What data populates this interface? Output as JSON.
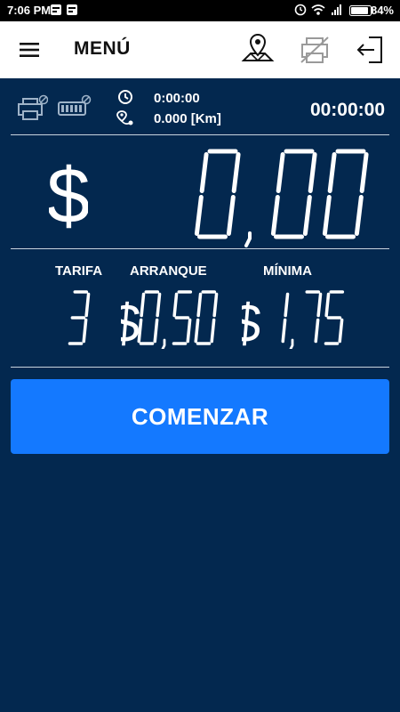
{
  "status_bar": {
    "time": "7:06 PM",
    "battery": "84%",
    "icons": [
      "notification-icon",
      "notification-icon",
      "alarm-icon",
      "wifi-icon",
      "signal-icon",
      "battery-icon"
    ]
  },
  "header": {
    "title": "MENÚ",
    "icons": [
      "hamburger-menu-icon",
      "map-location-icon",
      "printer-disabled-icon",
      "logout-icon"
    ]
  },
  "trip_info": {
    "device_icons": [
      "printer-disabled-icon",
      "taximeter-disabled-icon"
    ],
    "elapsed_time": "0:00:00",
    "distance": "0.000 [Km]",
    "clock": "00:00:00"
  },
  "fare": {
    "currency": "$",
    "amount": "0,00"
  },
  "rates": {
    "tarifa_label": "TARIFA",
    "tarifa_value": "3",
    "arranque_label": "ARRANQUE",
    "arranque_value": "$0,50",
    "minima_label": "MÍNIMA",
    "minima_value": "$ 1,75"
  },
  "actions": {
    "start_label": "COMENZAR"
  },
  "colors": {
    "background": "#03284f",
    "button": "#1479ff",
    "appbar": "#ffffff",
    "statusbar": "#000000"
  }
}
